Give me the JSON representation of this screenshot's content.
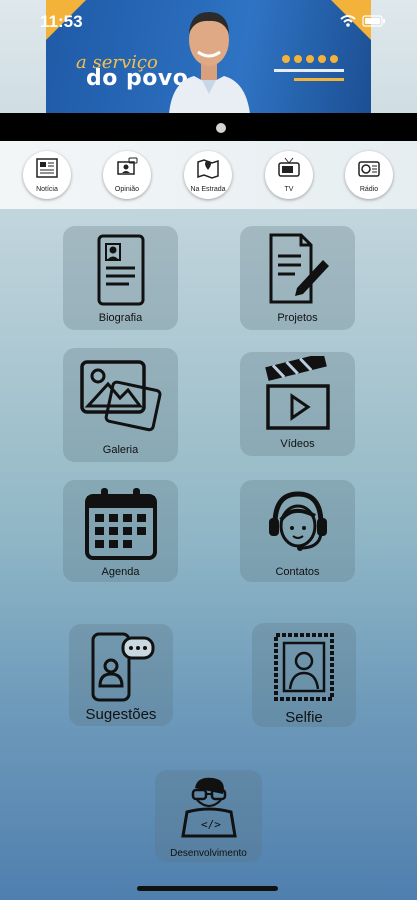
{
  "status": {
    "time": "11:53"
  },
  "banner": {
    "slogan_line1": "a serviço",
    "slogan_line2": "do povo"
  },
  "quick_nav": [
    {
      "label": "Notícia",
      "icon": "newspaper-icon"
    },
    {
      "label": "Opinião",
      "icon": "opinion-icon"
    },
    {
      "label": "Na Estrada",
      "icon": "map-icon"
    },
    {
      "label": "TV",
      "icon": "tv-icon"
    },
    {
      "label": "Rádio",
      "icon": "radio-icon"
    }
  ],
  "menu": [
    {
      "label": "Biografia",
      "icon": "biography-icon"
    },
    {
      "label": "Projetos",
      "icon": "document-pen-icon"
    },
    {
      "label": "Galeria",
      "icon": "gallery-icon"
    },
    {
      "label": "Vídeos",
      "icon": "clapperboard-icon"
    },
    {
      "label": "Agenda",
      "icon": "calendar-icon"
    },
    {
      "label": "Contatos",
      "icon": "headset-icon"
    },
    {
      "label": "Sugestões",
      "icon": "phone-chat-icon"
    },
    {
      "label": "Selfie",
      "icon": "portrait-frame-icon"
    },
    {
      "label": "Desenvolvimento",
      "icon": "developer-icon"
    }
  ]
}
